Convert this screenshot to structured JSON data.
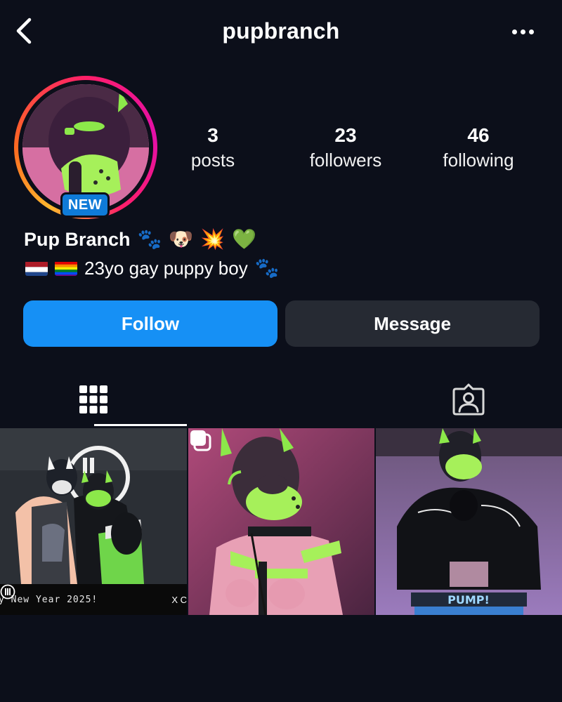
{
  "header": {
    "username": "pupbranch",
    "back_icon": "chevron-left-icon",
    "more_icon": "more-horizontal-icon"
  },
  "profile": {
    "badge": "NEW",
    "display_name": "Pup Branch",
    "name_emojis": [
      "🐾",
      "🐶",
      "💥",
      "💚"
    ],
    "bio_flags": [
      "netherlands-flag",
      "rainbow-flag"
    ],
    "bio_text": "23yo gay puppy boy",
    "bio_emoji": "🐾",
    "story_ring_colors": [
      "#ffb82e",
      "#ff6a21",
      "#ff1f69",
      "#e30fa8"
    ]
  },
  "stats": {
    "posts": {
      "value": "3",
      "label": "posts"
    },
    "followers": {
      "value": "23",
      "label": "followers"
    },
    "following": {
      "value": "46",
      "label": "following"
    }
  },
  "actions": {
    "follow_label": "Follow",
    "message_label": "Message",
    "follow_color": "#1690f5",
    "message_color": "#262a33"
  },
  "tabs": {
    "grid_icon": "grid-icon",
    "tagged_icon": "tagged-person-icon",
    "active": "grid"
  },
  "posts": [
    {
      "caption_left": "y New Year 2025!",
      "caption_right": "X C",
      "multi": false
    },
    {
      "multi": true
    },
    {
      "overlay_text": "PUMP!",
      "multi": false
    }
  ]
}
